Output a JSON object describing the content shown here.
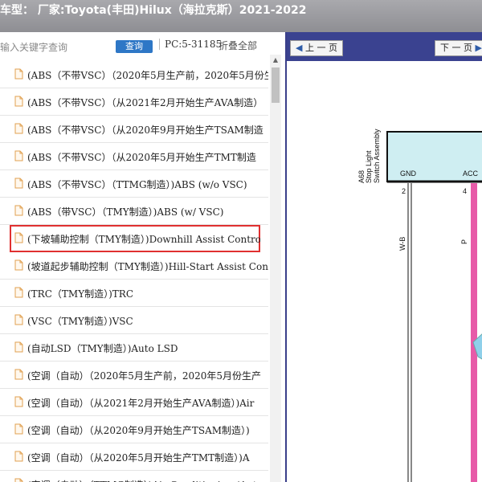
{
  "title": "车型： 厂家:Toyota(丰田)Hilux（海拉克斯）2021-2022",
  "search": {
    "placeholder": "输入关键字查询",
    "query_label": "查询",
    "pc_code": "PC:5-31185",
    "collapse_all": "折叠全部"
  },
  "tree_items": [
    "(ABS（不带VSC）（2020年5月生产前，2020年5月份生产",
    "(ABS（不带VSC）（从2021年2月开始生产AVA制造）",
    "(ABS（不带VSC）（从2020年9月开始生产TSAM制造",
    "(ABS（不带VSC）（从2020年5月开始生产TMT制造",
    "(ABS（不带VSC）（TTMG制造）)ABS (w/o VSC)",
    "(ABS（带VSC）（TMY制造）)ABS (w/ VSC)",
    "(下坡辅助控制（TMY制造）)Downhill Assist Control",
    "(坡道起步辅助控制（TMY制造）)Hill-Start Assist Control",
    "(TRC（TMY制造）)TRC",
    "(VSC（TMY制造）)VSC",
    "(自动LSD（TMY制造）)Auto LSD",
    "(空调（自动）（2020年5月生产前，2020年5月份生产",
    "(空调（自动）（从2021年2月开始生产AVA制造）)Air",
    "(空调（自动）（从2020年9月开始生产TSAM制造）)",
    "(空调（自动）（从2020年5月开始生产TMT制造）)A",
    "(空调（自动）（TTMG制造）)Air Conditioning (Aut"
  ],
  "selected_index": 6,
  "viewer": {
    "prev_label": "上 一 页",
    "next_label": "下 一 页"
  },
  "diagram": {
    "component_id": "A68",
    "component_name_line1": "Stop Light",
    "component_name_line2": "Switch Assembly",
    "pin_gnd": "GND",
    "pin_acc": "ACC",
    "pin_gnd_num": "2",
    "pin_acc_num": "4",
    "wire_wb": "W-B",
    "wire_p": "P"
  },
  "colors": {
    "selected_outline": "#e03030",
    "query_button": "#2e77c6",
    "toolbar": "#3a4290",
    "connector_fill": "#cfeef2",
    "pink_wire": "#e75aa8"
  }
}
